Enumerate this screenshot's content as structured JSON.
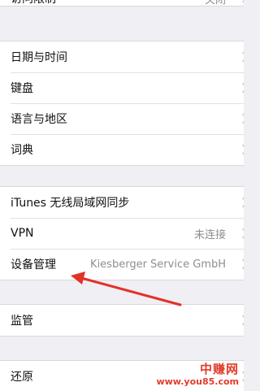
{
  "settings": {
    "top_partial": {
      "label": "访问限制",
      "value": "关闭"
    },
    "group_general": [
      {
        "label": "日期与时间"
      },
      {
        "label": "键盘"
      },
      {
        "label": "语言与地区"
      },
      {
        "label": "词典"
      }
    ],
    "group_sync": [
      {
        "label": "iTunes 无线局域网同步",
        "value": ""
      },
      {
        "label": "VPN",
        "value": "未连接"
      },
      {
        "label": "设备管理",
        "value": "Kiesberger Service GmbH"
      }
    ],
    "group_supervision": [
      {
        "label": "监管"
      }
    ],
    "group_reset": [
      {
        "label": "还原"
      }
    ]
  },
  "watermark": {
    "line1": "中赚网",
    "line2": "www.you85.com"
  },
  "colors": {
    "background": "#efeff4",
    "cell": "#ffffff",
    "arrow": "#e2322a",
    "chevron": "#c7c7cc"
  }
}
